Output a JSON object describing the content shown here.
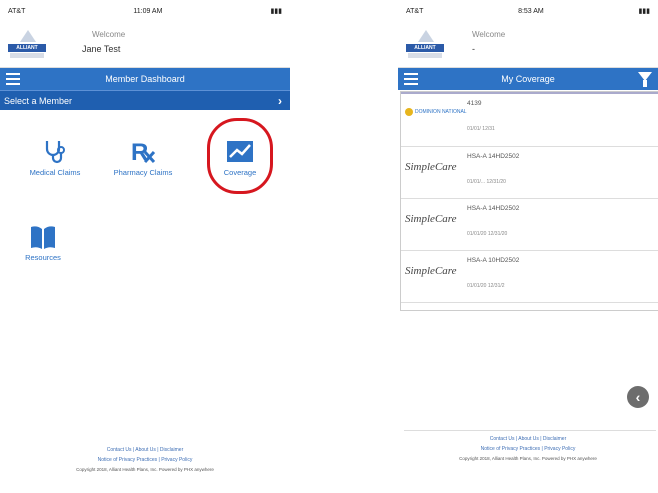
{
  "left": {
    "status": {
      "carrier": "AT&T",
      "time": "11:09 AM",
      "battery": "100"
    },
    "logo_text": "ALLIANT",
    "welcome": "Welcome",
    "user_name": "Jane Test",
    "nav_title": "Member Dashboard",
    "select_member": "Select a Member",
    "tiles": [
      {
        "label": "Medical Claims",
        "icon": "stethoscope-icon"
      },
      {
        "label": "Pharmacy Claims",
        "icon": "rx-icon"
      },
      {
        "label": "Coverage",
        "icon": "chart-icon"
      },
      {
        "label": "Resources",
        "icon": "book-icon"
      }
    ],
    "footer": {
      "line1": "Contact Us  |  About Us  |  Disclaimer",
      "line2": "Notice of Privacy Practices  |  Privacy Policy",
      "line3": "Copyright 2018, Alliant Health Plans, Inc. Powered by PHX anywhere"
    }
  },
  "right": {
    "status": {
      "carrier": "AT&T",
      "time": "8:53 AM",
      "battery": "100"
    },
    "logo_text": "ALLIANT",
    "welcome": "Welcome",
    "user_name": "-",
    "nav_title": "My Coverage",
    "cards": [
      {
        "carrier": "DOMINION NATIONAL",
        "plan": "4139",
        "dates": "01/01/     12/31"
      },
      {
        "carrier": "SimpleCare",
        "plan": "HSA-A 14HD2502",
        "dates": "01/01/...   12/31/20"
      },
      {
        "carrier": "SimpleCare",
        "plan": "HSA-A 14HD2502",
        "dates": "01/01/20   12/31/20"
      },
      {
        "carrier": "SimpleCare",
        "plan": "HSA-A 10HD2502",
        "dates": "01/01/20   12/31/2"
      }
    ],
    "footer": {
      "line1": "Contact Us  |  About Us  |  Disclaimer",
      "line2": "Notice of Privacy Practices  |  Privacy Policy",
      "line3": "Copyright 2018, Alliant Health Plans, Inc. Powered by PHX anywhere"
    }
  }
}
